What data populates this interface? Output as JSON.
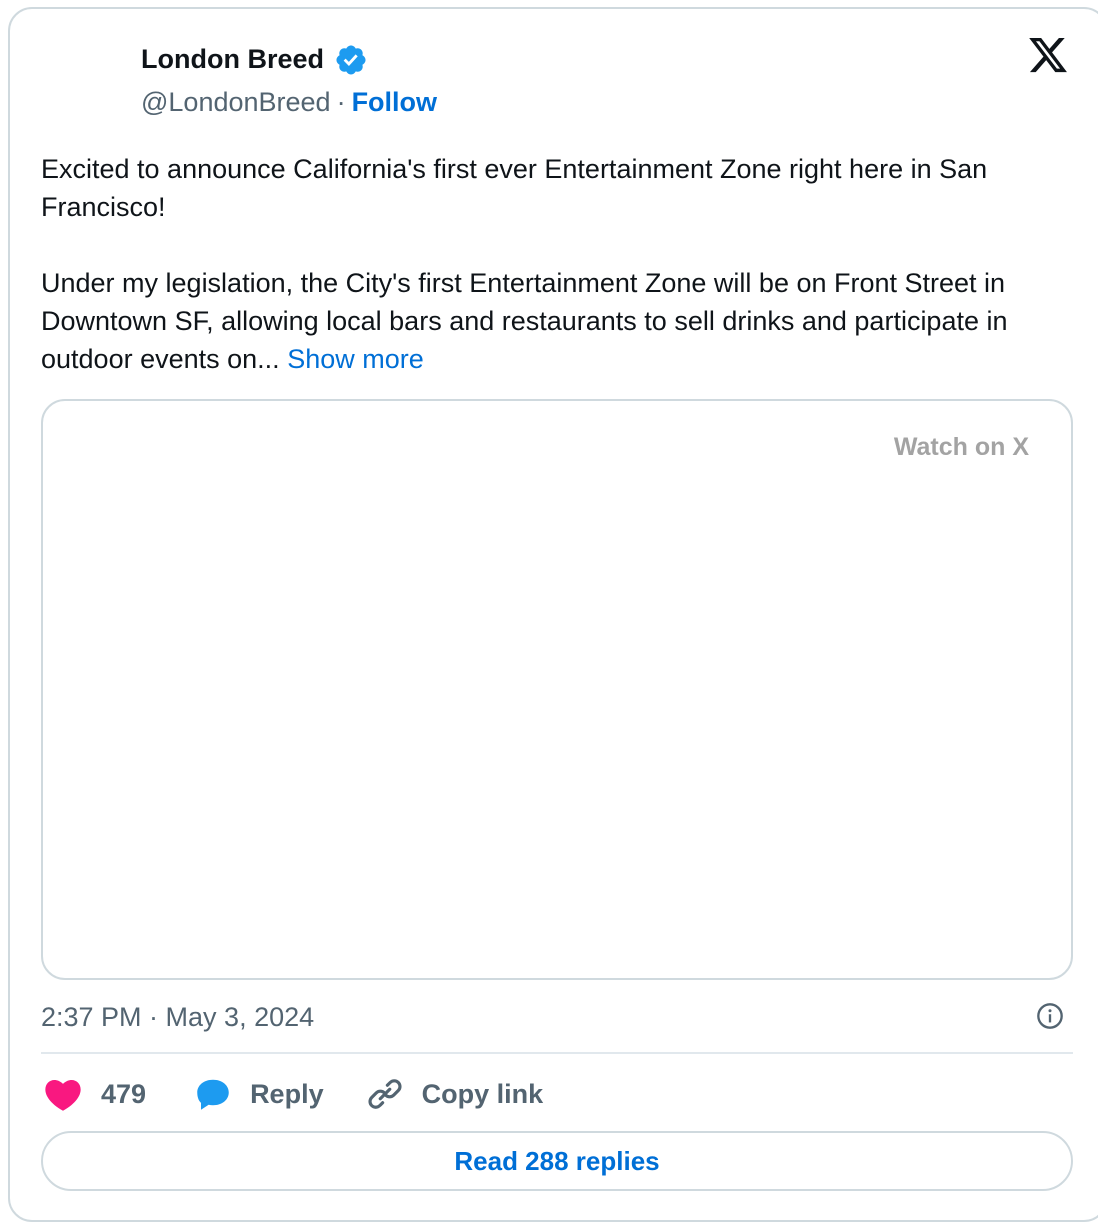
{
  "tweet": {
    "author_name": "London Breed",
    "handle": "@LondonBreed",
    "separator": "·",
    "follow_label": "Follow",
    "text_p1": "Excited to announce California's first ever Entertainment Zone right here in San Francisco!",
    "text_p2": "Under my legislation, the City's first Entertainment Zone will be on Front Street in Downtown SF, allowing local bars and restaurants to sell drinks and participate in outdoor events on...",
    "show_more_label": "Show more",
    "media_watch_label": "Watch on X",
    "timestamp": "2:37 PM · May 3, 2024",
    "like_count": "479",
    "reply_label": "Reply",
    "copy_link_label": "Copy link",
    "read_replies_label": "Read 288 replies"
  },
  "icons": {
    "logo": "x-logo-icon",
    "verified": "verified-badge-icon",
    "info": "info-icon",
    "like": "heart-icon",
    "reply": "speech-bubble-icon",
    "link": "link-icon"
  },
  "colors": {
    "accent": "#006fd6",
    "verified": "#1d9bf0",
    "like": "#f91880",
    "muted_text": "#536471",
    "border": "#cfd9de"
  }
}
